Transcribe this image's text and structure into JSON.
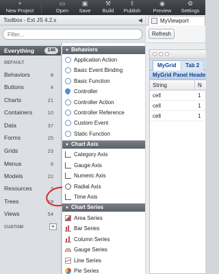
{
  "toolbar": {
    "items": [
      {
        "label": "New Project",
        "icon": "new-project-icon"
      },
      {
        "label": "Open",
        "icon": "open-folder-icon"
      },
      {
        "label": "Save",
        "icon": "save-icon"
      },
      {
        "label": "Build",
        "icon": "build-icon"
      },
      {
        "label": "Publish",
        "icon": "publish-icon"
      },
      {
        "label": "Preview",
        "icon": "preview-icon"
      },
      {
        "label": "Settings",
        "icon": "settings-icon"
      }
    ]
  },
  "toolbox": {
    "title": "Toolbox - Ext JS 4.2.x",
    "filter_placeholder": "Filter...",
    "everything": {
      "label": "Everything",
      "count": "146"
    },
    "default_header": "DEFAULT",
    "custom_header": "CUSTOM",
    "add_label": "+",
    "categories": [
      {
        "label": "Behaviors",
        "count": "8"
      },
      {
        "label": "Buttons",
        "count": "4"
      },
      {
        "label": "Charts",
        "count": "21"
      },
      {
        "label": "Containers",
        "count": "10"
      },
      {
        "label": "Data",
        "count": "37"
      },
      {
        "label": "Forms",
        "count": "25"
      },
      {
        "label": "Grids",
        "count": "23"
      },
      {
        "label": "Menus",
        "count": "6"
      },
      {
        "label": "Models",
        "count": "22"
      },
      {
        "label": "Resources",
        "count": "3"
      },
      {
        "label": "Trees",
        "count": "18"
      },
      {
        "label": "Views",
        "count": "54"
      }
    ],
    "groups": {
      "behaviors": {
        "label": "Behaviors",
        "items": [
          "Application Action",
          "Basic Event Binding",
          "Basic Function",
          "Controller",
          "Controller Action",
          "Controller Reference",
          "Custom Event",
          "Static Function"
        ]
      },
      "chart_axis": {
        "label": "Chart Axis",
        "items": [
          "Category Axis",
          "Gauge Axis",
          "Numeric Axis",
          "Radial Axis",
          "Time Axis"
        ]
      },
      "chart_series": {
        "label": "Chart Series",
        "items": [
          "Area Series",
          "Bar Series",
          "Column Series",
          "Gauge Series",
          "Line Series",
          "Pie Series"
        ]
      }
    }
  },
  "viewport": {
    "tab_label": "MyViewport",
    "refresh_label": "Refresh",
    "tabs": [
      "MyGrid",
      "Tab 2"
    ],
    "panel_title": "MyGrid Panel Header",
    "columns": [
      "String",
      "N"
    ],
    "rows": [
      [
        "cell",
        "1"
      ],
      [
        "cell",
        "1"
      ],
      [
        "cell",
        "1"
      ]
    ]
  },
  "colors": {
    "toolbar_bg": "#3a3d42",
    "selected_category": "#5a5f66",
    "group_header": "#6b7077",
    "annotation_circle": "#d8262c",
    "grid_header_text": "#15428b"
  }
}
